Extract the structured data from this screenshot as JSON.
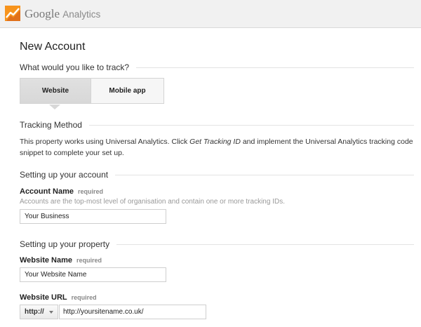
{
  "header": {
    "brand_google": "Google",
    "brand_product": "Analytics",
    "logo_icon": "google-analytics-logo-icon",
    "logo_color": "#f7941d"
  },
  "page": {
    "title": "New Account"
  },
  "track": {
    "question": "What would you like to track?",
    "options": [
      "Website",
      "Mobile app"
    ],
    "selected": "Website"
  },
  "tracking_method": {
    "heading": "Tracking Method",
    "text_before": "This property works using Universal Analytics. Click ",
    "link_text": "Get Tracking ID",
    "text_after": " and implement the Universal Analytics tracking code snippet to complete your set up."
  },
  "account": {
    "heading": "Setting up your account",
    "name_label": "Account Name",
    "required": "required",
    "hint": "Accounts are the top-most level of organisation and contain one or more tracking IDs.",
    "name_value": "Your Business"
  },
  "property": {
    "heading": "Setting up your property",
    "website_name_label": "Website Name",
    "website_name_required": "required",
    "website_name_value": "Your Website Name",
    "url_label": "Website URL",
    "url_required": "required",
    "protocol": "http://",
    "url_value": "http://yoursitename.co.uk/"
  }
}
